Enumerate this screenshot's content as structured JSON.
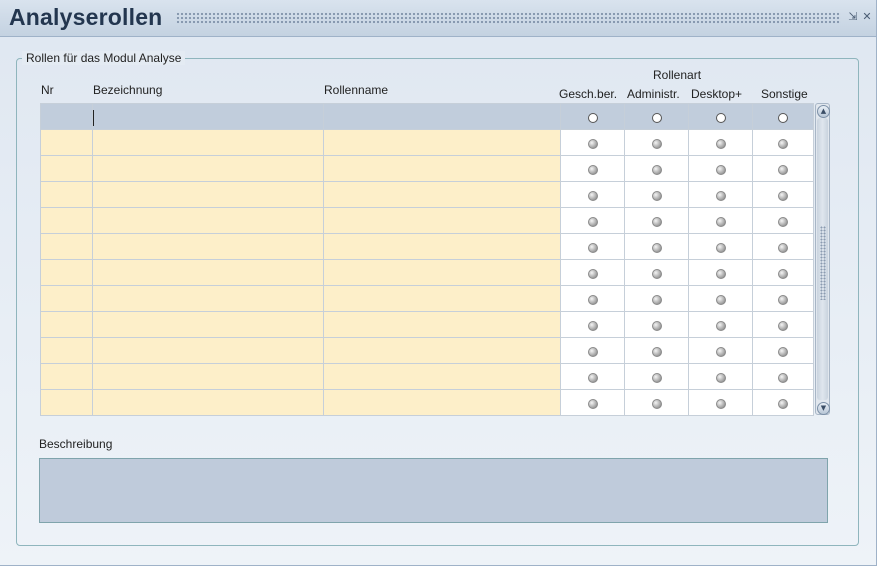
{
  "window": {
    "title": "Analyserollen",
    "minimize_glyph": "⇲",
    "close_glyph": "✕"
  },
  "group": {
    "label": "Rollen für das Modul Analyse"
  },
  "table": {
    "headers": {
      "nr": "Nr",
      "bezeichnung": "Bezeichnung",
      "rollenname": "Rollenname",
      "rollenart": "Rollenart",
      "radio_columns": [
        "Gesch.ber.",
        "Administr.",
        "Desktop+",
        "Sonstige"
      ]
    },
    "row_count": 12,
    "selected_row_index": 0
  },
  "description": {
    "label": "Beschreibung",
    "value": ""
  },
  "colors": {
    "editable_cell": "#fdefc9",
    "selected_row": "#c1cddc",
    "title_text": "#23364f"
  }
}
